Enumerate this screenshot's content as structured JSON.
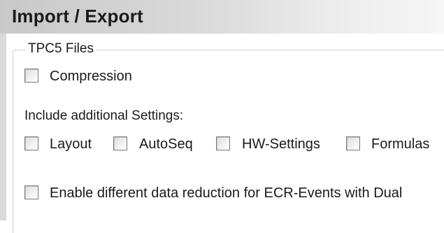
{
  "panel": {
    "title": "Import / Export"
  },
  "group": {
    "legend": "TPC5 Files",
    "compression": {
      "label": "Compression",
      "checked": false
    },
    "additional_settings_label": "Include additional Settings:",
    "settings": [
      {
        "label": "Layout",
        "checked": false
      },
      {
        "label": "AutoSeq",
        "checked": false
      },
      {
        "label": "HW-Settings",
        "checked": false
      },
      {
        "label": "Formulas",
        "checked": false
      }
    ],
    "data_reduction": {
      "label": "Enable different data reduction for ECR-Events with Dual",
      "checked": false
    }
  }
}
